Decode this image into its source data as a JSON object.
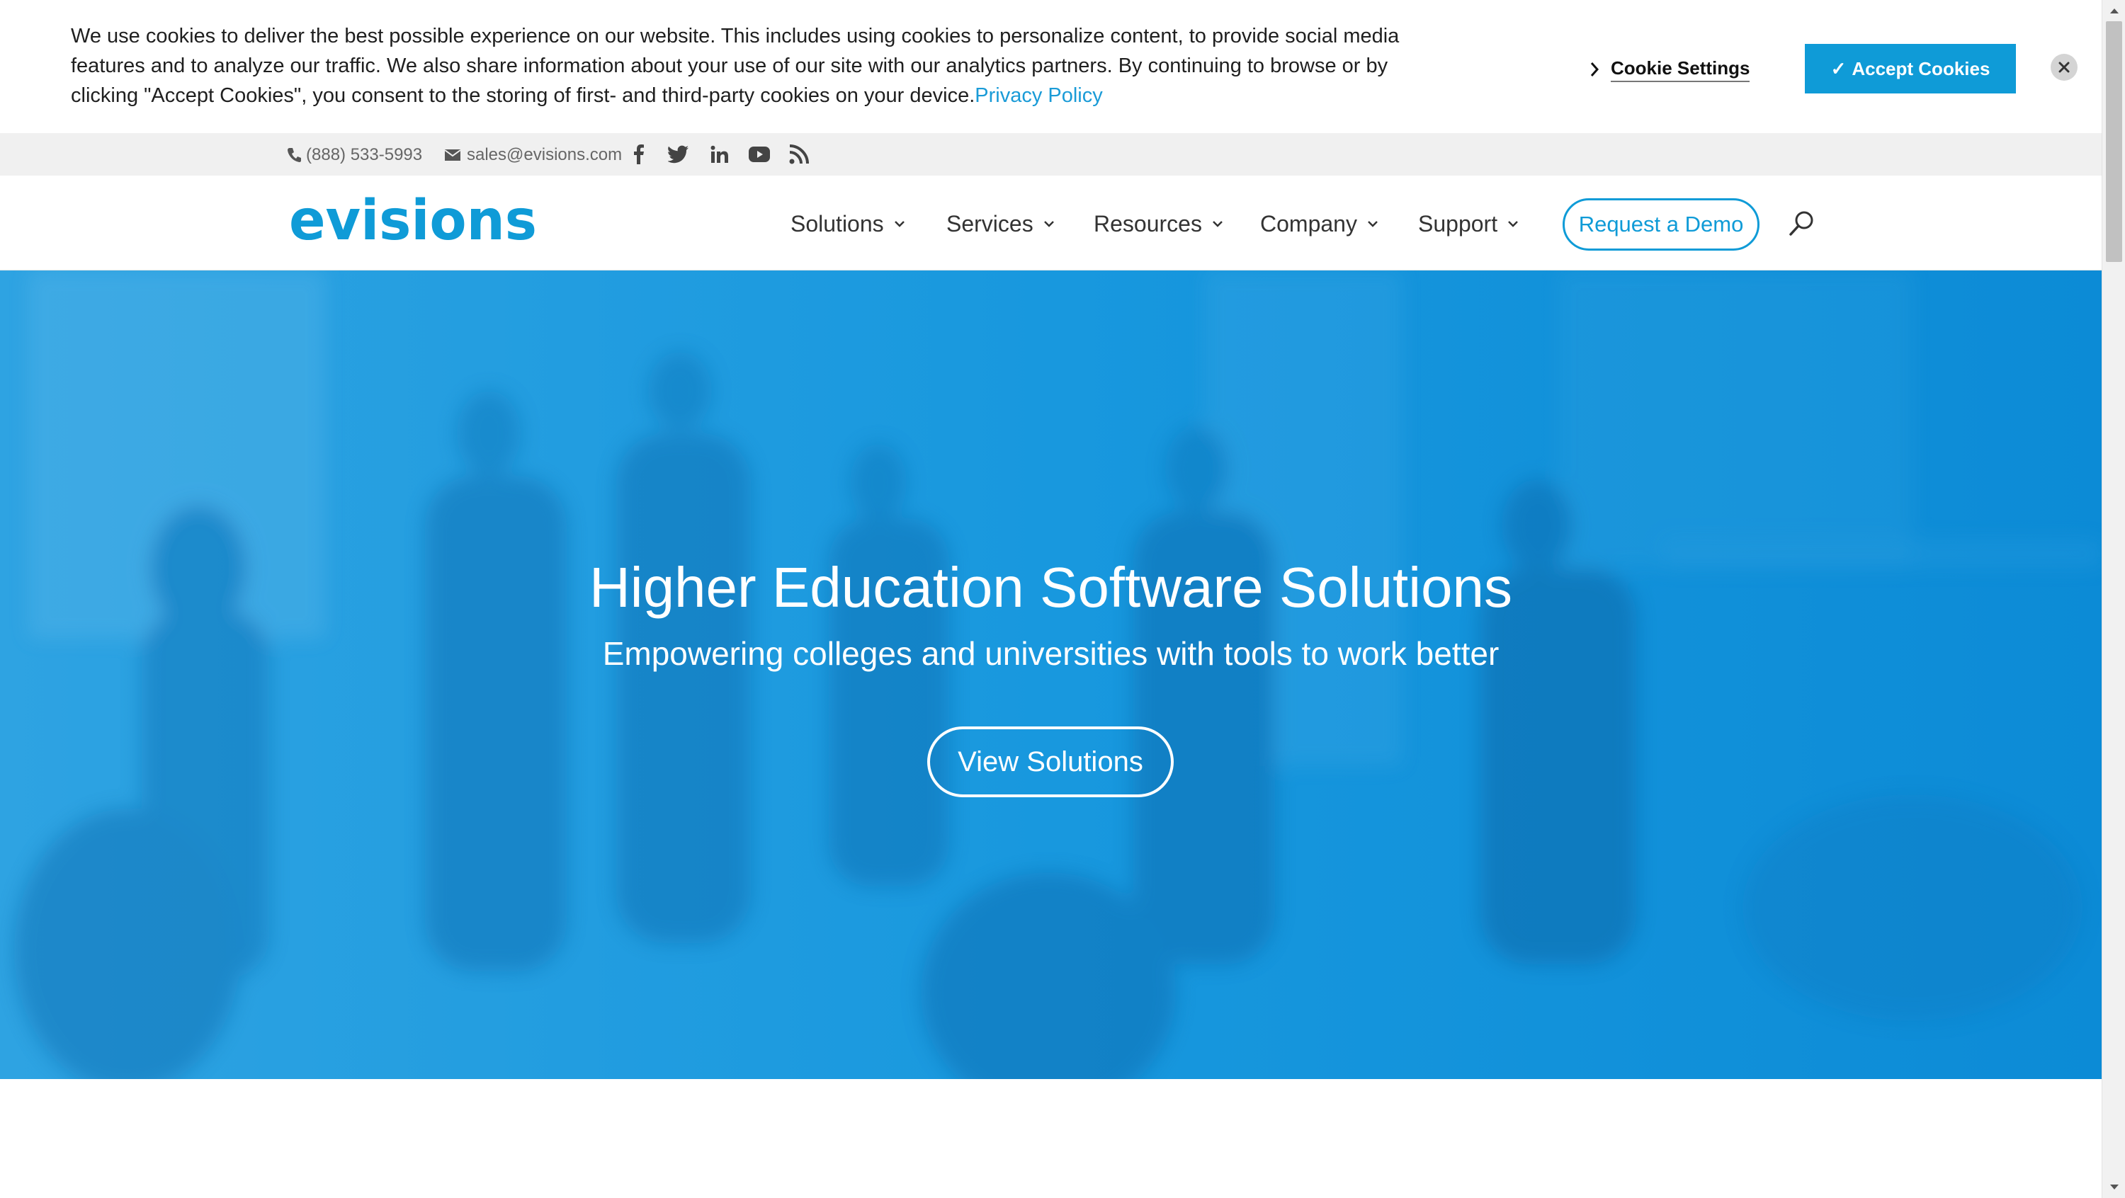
{
  "cookie_banner": {
    "message": "We use cookies to deliver the best possible experience on our website. This includes using cookies to personalize content, to provide social media features and to analyze our traffic. We also share information about your use of our site with our analytics partners. By continuing to browse or by clicking \"Accept Cookies\", you consent to the storing of first- and third-party cookies on your device.",
    "privacy_link": "Privacy Policy",
    "settings_label": "Cookie Settings",
    "accept_label": "Accept Cookies",
    "accept_check": "✓"
  },
  "top_bar": {
    "phone": "(888) 533-5993",
    "email": "sales@evisions.com",
    "social_icons": [
      "facebook-icon",
      "twitter-icon",
      "linkedin-icon",
      "youtube-icon",
      "rss-icon"
    ]
  },
  "header": {
    "logo_text": "evisions",
    "nav": [
      {
        "label": "Solutions"
      },
      {
        "label": "Services"
      },
      {
        "label": "Resources"
      },
      {
        "label": "Company"
      },
      {
        "label": "Support"
      }
    ],
    "cta": "Request a Demo"
  },
  "hero": {
    "title": "Higher Education Software Solutions",
    "subtitle": "Empowering colleges and universities with tools to work better",
    "button": "View Solutions"
  },
  "colors": {
    "brand": "#0f9bd7",
    "hero_overlay": "#1696dc",
    "topbar_bg": "#f0f0f0"
  }
}
